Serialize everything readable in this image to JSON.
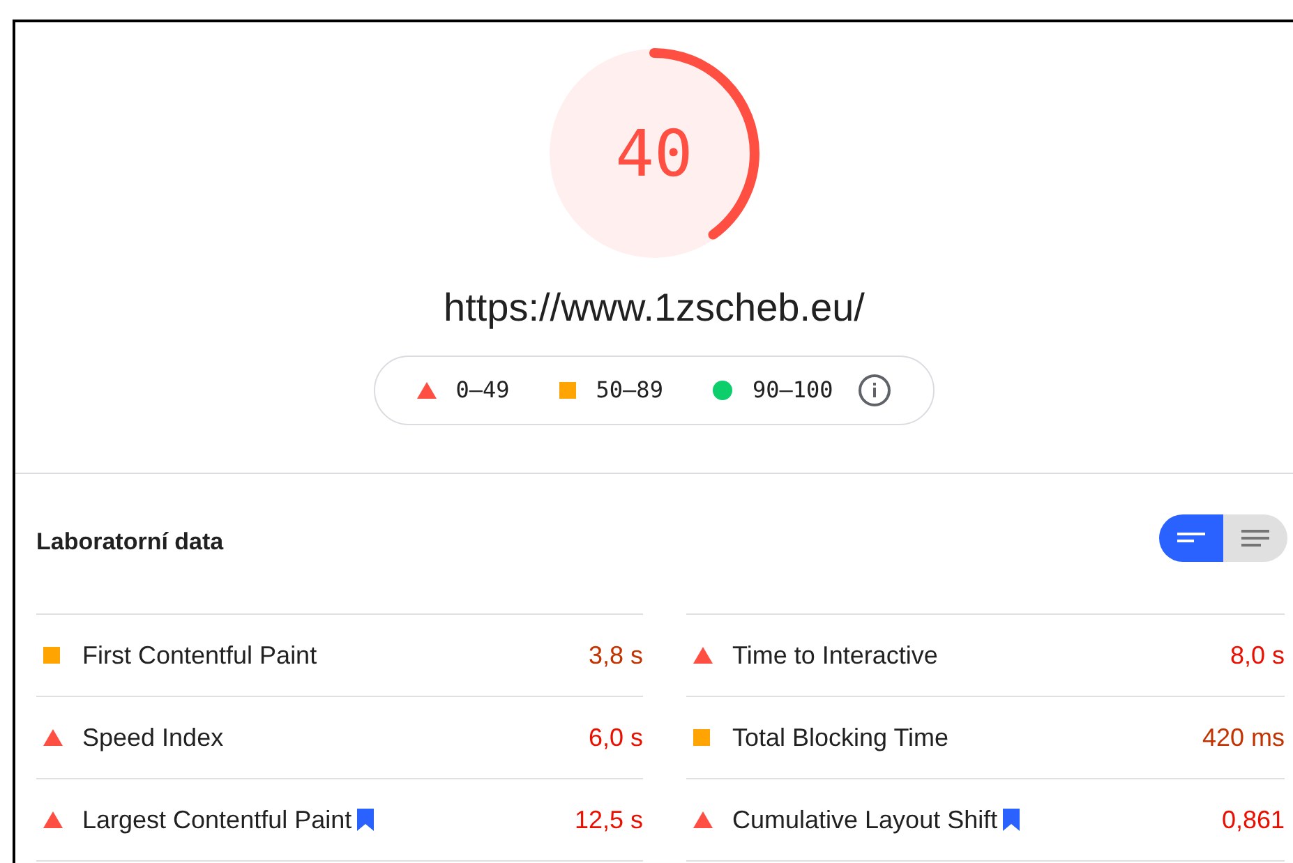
{
  "score": {
    "value": "40",
    "level": 0.4,
    "kind": "fail"
  },
  "url": "https://www.1zscheb.eu/",
  "legend": [
    {
      "kind": "fail",
      "label": "0–49"
    },
    {
      "kind": "average",
      "label": "50–89"
    },
    {
      "kind": "pass",
      "label": "90–100"
    }
  ],
  "section_title": "Laboratorní data",
  "view_toggle": [
    {
      "kind": "compact",
      "selected": true
    },
    {
      "kind": "expanded",
      "selected": false
    }
  ],
  "metrics": [
    {
      "name": "First Contentful Paint",
      "value": "3,8 s",
      "kind": "average",
      "flagged": false
    },
    {
      "name": "Time to Interactive",
      "value": "8,0 s",
      "kind": "fail",
      "flagged": false
    },
    {
      "name": "Speed Index",
      "value": "6,0 s",
      "kind": "fail",
      "flagged": false
    },
    {
      "name": "Total Blocking Time",
      "value": "420 ms",
      "kind": "average",
      "flagged": false
    },
    {
      "name": "Largest Contentful Paint",
      "value": "12,5 s",
      "kind": "fail",
      "flagged": true
    },
    {
      "name": "Cumulative Layout Shift",
      "value": "0,861",
      "kind": "fail",
      "flagged": true
    }
  ]
}
